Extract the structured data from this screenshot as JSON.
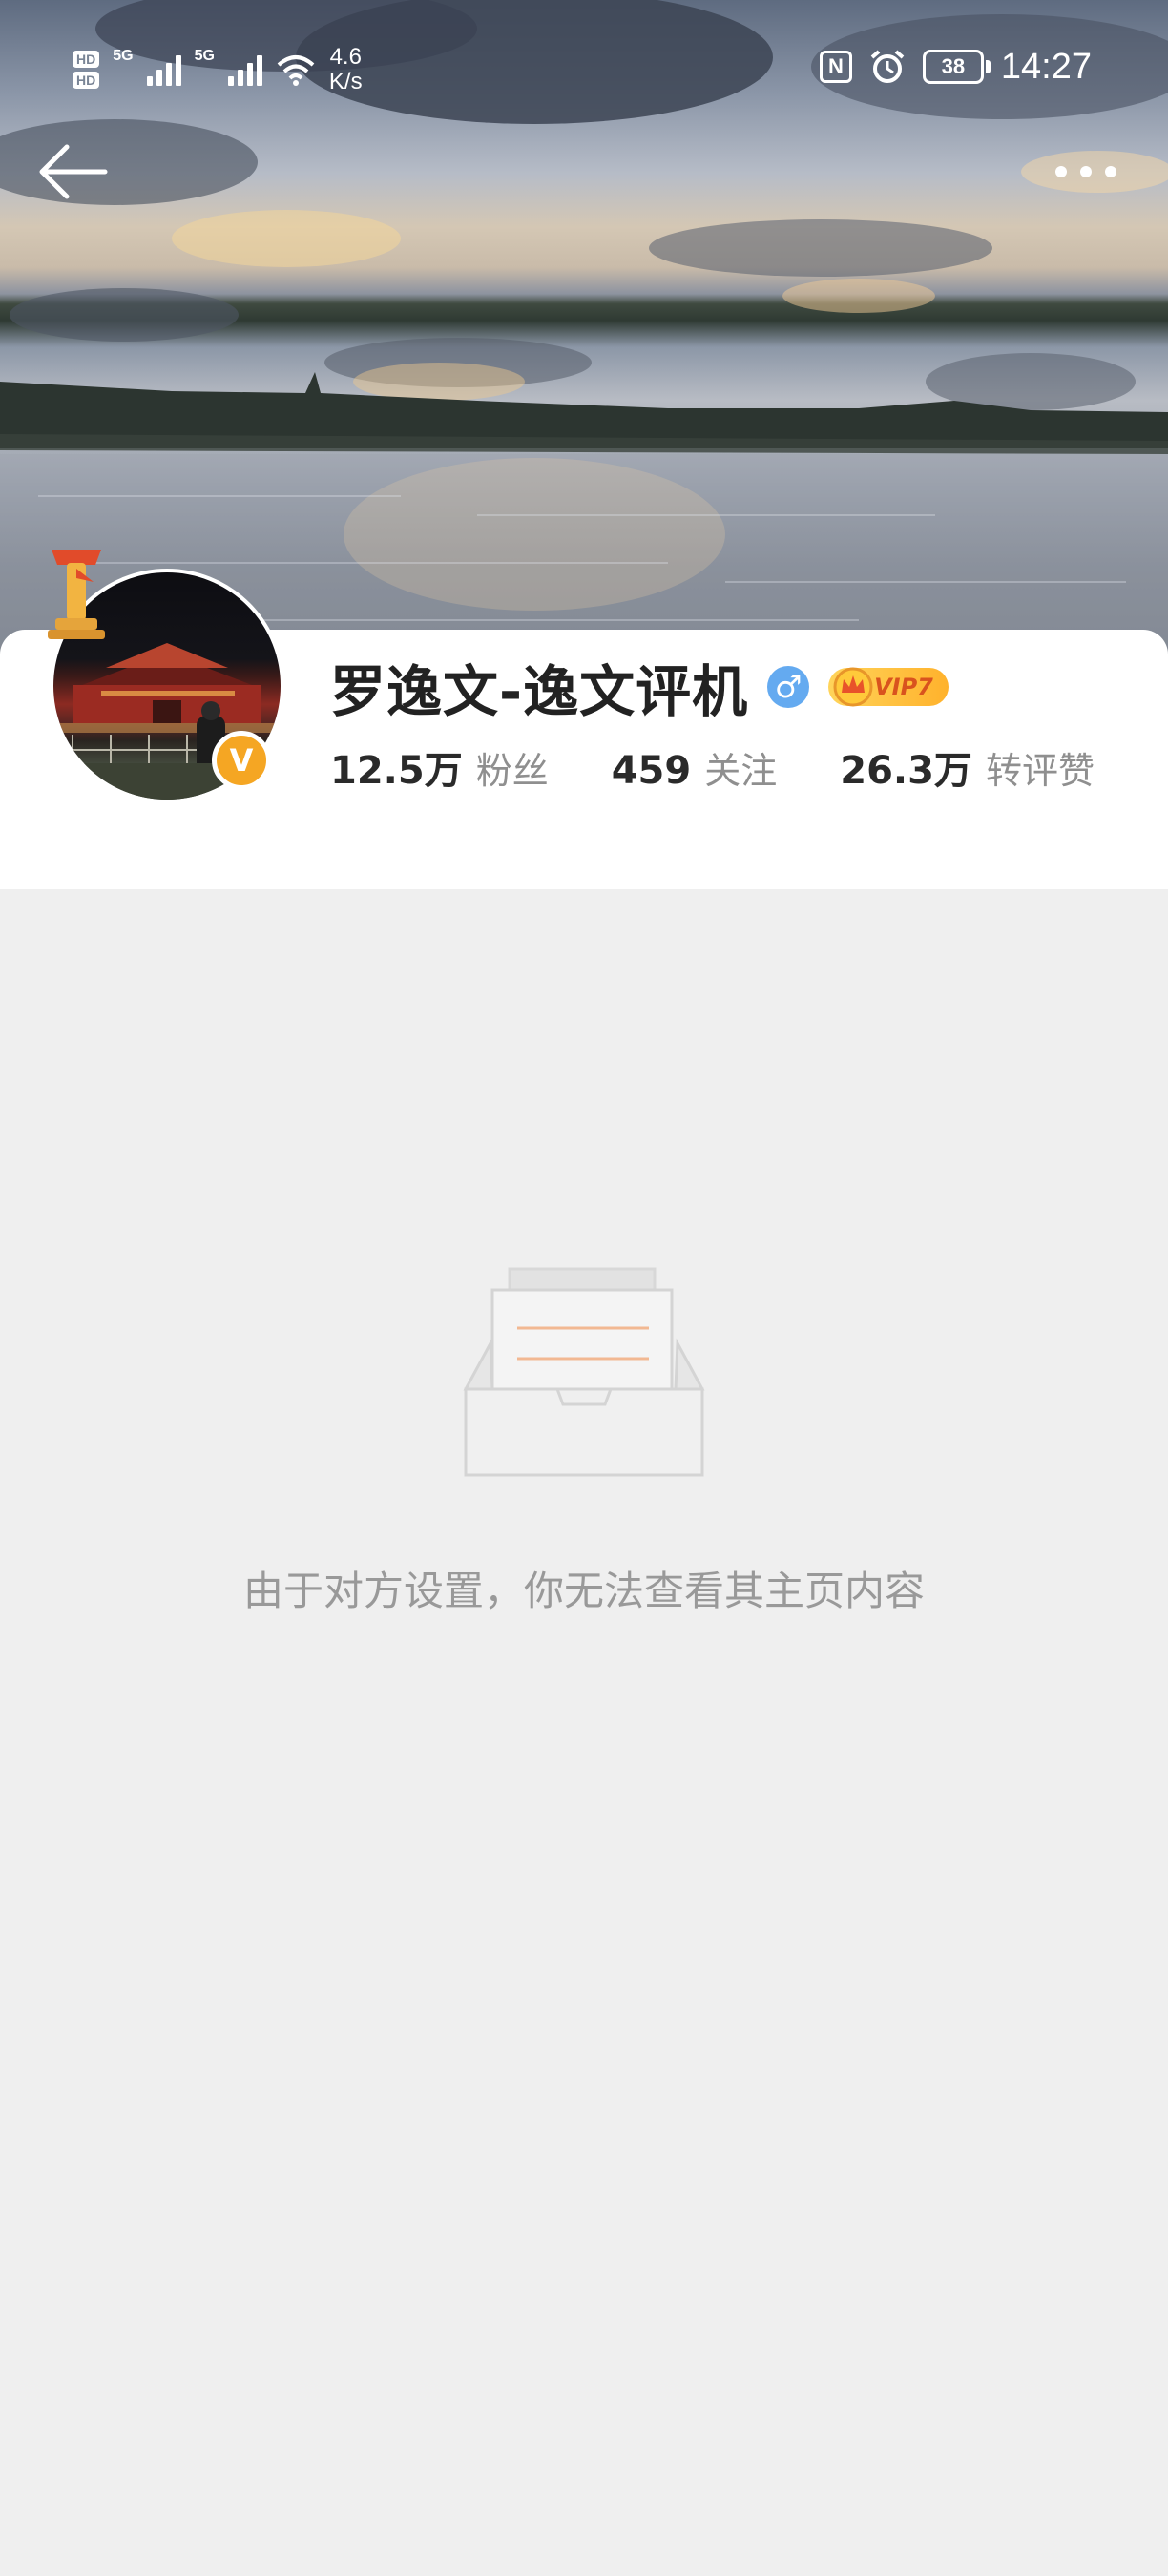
{
  "status_bar": {
    "hd_1": "HD",
    "hd_2": "HD",
    "network_1": "5G",
    "network_2": "5G",
    "speed_value": "4.6",
    "speed_unit": "K/s",
    "nfc": "N",
    "battery": "38",
    "time": "14:27"
  },
  "nav": {
    "back_icon": "arrow-left-icon",
    "more_icon": "more-dots-icon"
  },
  "profile": {
    "name": "罗逸文-逸文评机",
    "gender_symbol": "♂",
    "vip_label": "VIP7",
    "verified_badge": "V",
    "stats": [
      {
        "value": "12.5万",
        "label": "粉丝"
      },
      {
        "value": "459",
        "label": "关注"
      },
      {
        "value": "26.3万",
        "label": "转评赞"
      }
    ]
  },
  "empty_state": {
    "icon": "empty-inbox-icon",
    "message": "由于对方设置，你无法查看其主页内容"
  },
  "colors": {
    "page_background": "#efefef",
    "card_background": "#ffffff",
    "vip_gold": "#ffb22c",
    "verified_badge": "#f5a623",
    "gender_blue": "#64aaf0",
    "empty_text": "#999999"
  }
}
